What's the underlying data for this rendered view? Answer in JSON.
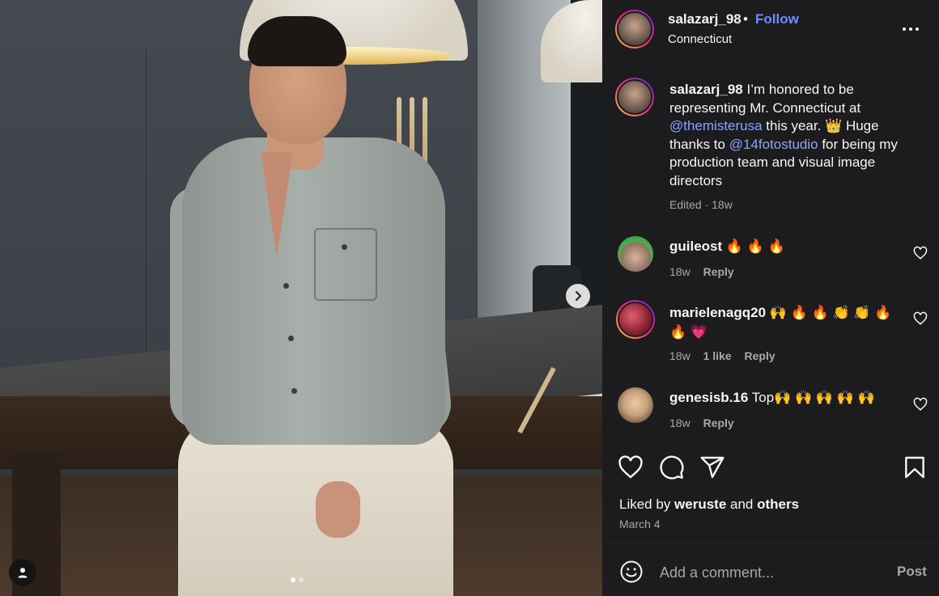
{
  "post": {
    "username": "salazarj_98",
    "separator": "•",
    "follow_label": "Follow",
    "location": "Connecticut",
    "more_icon": "more-horizontal-icon"
  },
  "caption": {
    "username": "salazarj_98",
    "text_1": " I’m honored to be representing Mr. Connecticut at ",
    "mention_1": "@themisterusa",
    "text_2": " this year. 👑 Huge thanks to ",
    "mention_2": "@14fotostudio",
    "text_3": " for being my production team and visual image directors",
    "meta": "Edited · 18w"
  },
  "comments": [
    {
      "username": "guileost",
      "text": " 🔥 🔥 🔥",
      "time": "18w",
      "likes": "",
      "reply": "Reply"
    },
    {
      "username": "marielenagq20",
      "text": " 🙌 🔥 🔥 👏 👏 🔥 🔥 💗",
      "time": "18w",
      "likes": "1 like",
      "reply": "Reply"
    },
    {
      "username": "genesisb.16",
      "text": " Top🙌 🙌 🙌 🙌 🙌",
      "time": "18w",
      "likes": "",
      "reply": "Reply"
    }
  ],
  "likes": {
    "prefix": "Liked by ",
    "user": "weruste",
    "middle": " and ",
    "others": "others"
  },
  "date": "March 4",
  "comment_box": {
    "placeholder": "Add a comment...",
    "post_label": "Post"
  },
  "colors": {
    "accent": "#6b8cff",
    "panel_bg": "#1c1c1e",
    "mention": "#8aa4ff"
  },
  "carousel": {
    "current": 1,
    "total": 2
  }
}
